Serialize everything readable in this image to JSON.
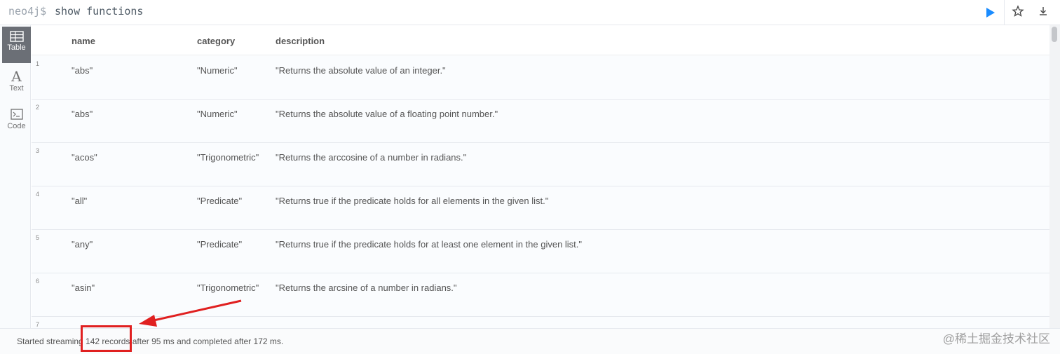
{
  "editor": {
    "prompt": "neo4j$",
    "query": "show functions",
    "run_icon": "play-icon",
    "favorite_icon": "star-icon",
    "download_icon": "download-icon"
  },
  "sidebar": {
    "tabs": [
      {
        "label": "Table",
        "icon": "table-icon",
        "active": true
      },
      {
        "label": "Text",
        "icon": "text-icon",
        "glyph": "A"
      },
      {
        "label": "Code",
        "icon": "code-terminal-icon"
      }
    ]
  },
  "table": {
    "columns": [
      "name",
      "category",
      "description"
    ],
    "rows": [
      {
        "index": "1",
        "name": "\"abs\"",
        "category": "\"Numeric\"",
        "description": "\"Returns the absolute value of an integer.\""
      },
      {
        "index": "2",
        "name": "\"abs\"",
        "category": "\"Numeric\"",
        "description": "\"Returns the absolute value of a floating point number.\""
      },
      {
        "index": "3",
        "name": "\"acos\"",
        "category": "\"Trigonometric\"",
        "description": "\"Returns the arccosine of a number in radians.\""
      },
      {
        "index": "4",
        "name": "\"all\"",
        "category": "\"Predicate\"",
        "description": "\"Returns true if the predicate holds for all elements in the given list.\""
      },
      {
        "index": "5",
        "name": "\"any\"",
        "category": "\"Predicate\"",
        "description": "\"Returns true if the predicate holds for at least one element in the given list.\""
      },
      {
        "index": "6",
        "name": "\"asin\"",
        "category": "\"Trigonometric\"",
        "description": "\"Returns the arcsine of a number in radians.\""
      },
      {
        "index": "7",
        "name": "",
        "category": "",
        "description": ""
      }
    ]
  },
  "status": {
    "prefix": "Started streaming ",
    "records": "142 records",
    "suffix": " after 95 ms and completed after 172 ms."
  },
  "annotation": {
    "color": "#e02020"
  },
  "watermark": "@稀土掘金技术社区",
  "colors": {
    "accent": "#1a8cff",
    "active_tab": "#6b6f76"
  }
}
